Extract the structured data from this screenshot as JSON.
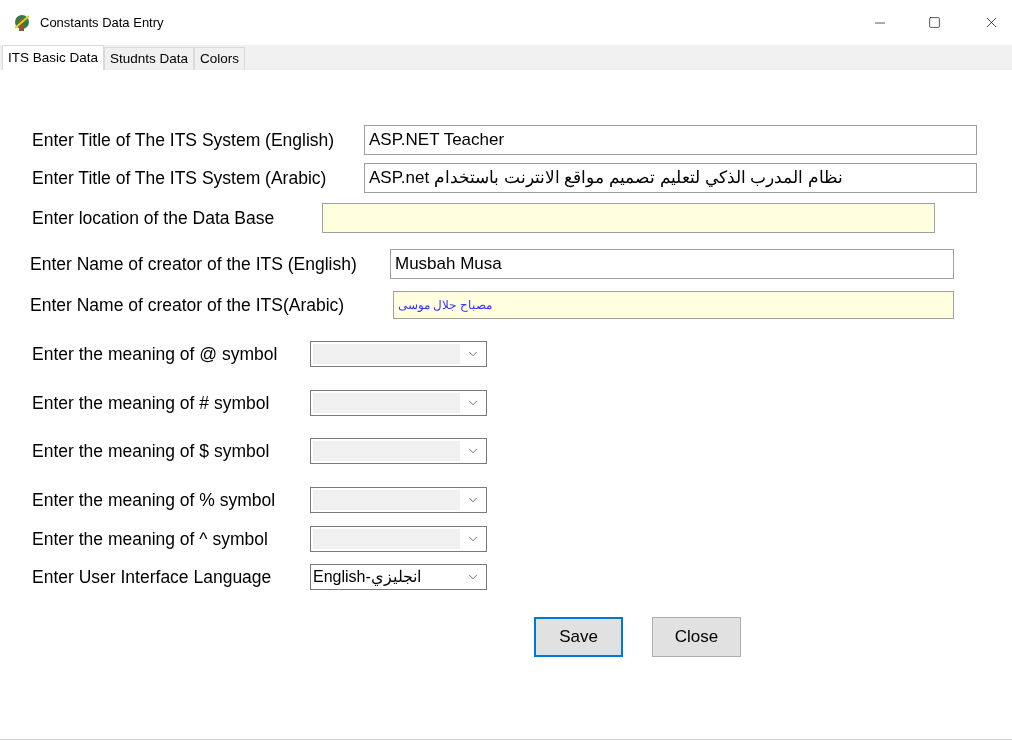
{
  "window": {
    "title": "Constants Data Entry"
  },
  "tabs": [
    {
      "label": "ITS Basic Data",
      "selected": true
    },
    {
      "label": "Studnts Data",
      "selected": false
    },
    {
      "label": "Colors",
      "selected": false
    }
  ],
  "fields": [
    {
      "kind": "text",
      "label": "Enter Title of The ITS System (English)",
      "value": "ASP.NET Teacher",
      "highlighted": false
    },
    {
      "kind": "text",
      "label": "Enter Title of The ITS System (Arabic)",
      "value": "نظام المدرب الذكي لتعليم تصميم مواقع الانترنت باستخدام ASP.net",
      "highlighted": false
    },
    {
      "kind": "text",
      "label": "Enter location of the Data Base",
      "highlighted": true
    },
    {
      "kind": "text",
      "label": "Enter Name of creator of the ITS (English)",
      "value": "Musbah Musa",
      "highlighted": false
    },
    {
      "kind": "text",
      "label": "Enter Name of creator of the ITS(Arabic)",
      "value": "مصباح جلال موسى",
      "highlighted": true
    },
    {
      "kind": "combo",
      "label": "Enter the meaning of @ symbol"
    },
    {
      "kind": "combo",
      "label": "Enter the meaning of # symbol"
    },
    {
      "kind": "combo",
      "label": "Enter the meaning of $ symbol"
    },
    {
      "kind": "combo",
      "label": "Enter the meaning of % symbol"
    },
    {
      "kind": "combo",
      "label": "Enter the meaning of ^ symbol"
    },
    {
      "kind": "combo",
      "label": "Enter User Interface Language",
      "value": "English-انجليزي"
    }
  ],
  "buttons": [
    {
      "label": "Save",
      "selected": true
    },
    {
      "label": "Close",
      "selected": false
    }
  ]
}
